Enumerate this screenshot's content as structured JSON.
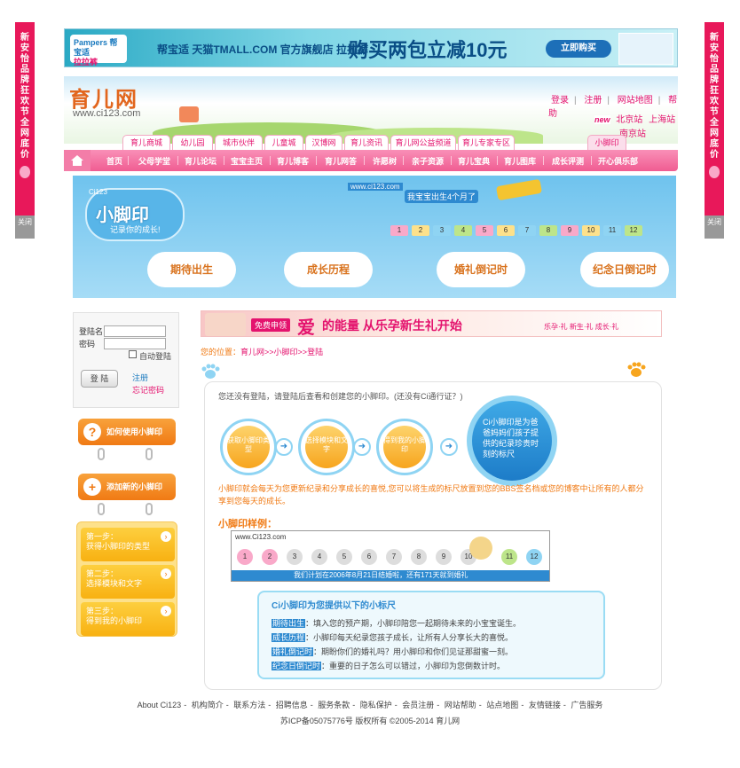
{
  "side_banner": {
    "text": "新安怡品牌狂欢节 全网底价",
    "close": "关闭"
  },
  "top_ad": {
    "brand": "Pampers 帮宝适",
    "lala": "拉拉裤",
    "store": "帮宝适 天猫TMALL.COM 官方旗舰店 拉拉裤",
    "promo": "购买两包立减10元",
    "button": "立即购买"
  },
  "header": {
    "logo": "育儿网",
    "logo_url": "www.ci123.com",
    "links": [
      "登录",
      "注册",
      "网站地图",
      "帮助"
    ],
    "new_badge": "new",
    "cities": [
      "北京站",
      "上海站"
    ],
    "nanjing": "南京站"
  },
  "tabs": [
    "育儿商城",
    "幼儿园",
    "城市伙伴",
    "儿童城",
    "汉博网",
    "育儿资讯",
    "育儿网公益频道",
    "育儿专家专区",
    "小脚印"
  ],
  "nav": [
    "首页",
    "父母学堂",
    "育儿论坛",
    "宝宝主页",
    "育儿博客",
    "育儿网答",
    "许愿树",
    "亲子资源",
    "育儿宝典",
    "育儿图库",
    "成长评测",
    "开心俱乐部"
  ],
  "banner": {
    "small": "Ci123",
    "title": "小脚印",
    "subtitle": "记录你的成长!",
    "url": "www.ci123.com",
    "bubble": "我宝宝出生4个月了",
    "numbers": [
      "1",
      "2",
      "3",
      "4",
      "5",
      "6",
      "7",
      "8",
      "9",
      "10",
      "11",
      "12"
    ],
    "clouds": [
      "期待出生",
      "成长历程",
      "婚礼倒记时",
      "纪念日倒记时"
    ]
  },
  "login": {
    "username_label": "登陆名",
    "password_label": "密码",
    "auto": "自动登陆",
    "button": "登 陆",
    "register": "注册",
    "forgot": "忘记密码"
  },
  "side_buttons": {
    "how": "如何使用小脚印",
    "add": "添加新的小脚印"
  },
  "steps": [
    {
      "title": "第一步：",
      "text": "获得小脚印的类型"
    },
    {
      "title": "第二步：",
      "text": "选择模块和文字"
    },
    {
      "title": "第三步：",
      "text": "得到我的小脚印"
    }
  ],
  "ad_bar": {
    "free": "免费申领",
    "love": "爱",
    "slogan": "的能量 从乐孕新生礼开始",
    "small": "乐孕·礼 新生·礼 成长·礼"
  },
  "breadcrumb": {
    "prefix": "您的位置：",
    "home": "育儿网",
    "mid": ">>小脚印>>",
    "current": "登陆"
  },
  "content": {
    "notice": "您还没有登陆，请登陆后查看和创建您的小脚印。(还没有Ci通行证？)",
    "flow": [
      "获取小脚印类型",
      "选择模块和文字",
      "得到我的小脚印"
    ],
    "circle": "Ci小脚印是为爸爸妈妈们孩子提供的纪录珍贵时刻的标尺",
    "desc": "小脚印就会每天为您更新纪录和分享成长的喜悦,您可以将生成的标尺放置到您的BBS签名档或您的博客中让所有的人都分享到您每天的成长。",
    "sample_heading": "小脚印样例：",
    "sample_url": "www.Ci123.com",
    "sample_text": "我们计划在2006年8月21日结婚啦，还有171天就到婚礼",
    "sample_nums": [
      "1",
      "2",
      "3",
      "4",
      "5",
      "6",
      "7",
      "8",
      "9",
      "10",
      "11",
      "12"
    ],
    "info_title": "Ci小脚印为您提供以下的小标尺",
    "info_rows": [
      {
        "key": "期待出生",
        "text": "：填入您的预产期，小脚印陪您一起期待未来的小宝宝诞生。"
      },
      {
        "key": "成长历程",
        "text": "：小脚印每天纪录您孩子成长，让所有人分享长大的喜悦。"
      },
      {
        "key": "婚礼倒记时",
        "text": "：期盼你们的婚礼吗？用小脚印和你们见证那甜蜜一刻。"
      },
      {
        "key": "纪念日倒记时",
        "text": "：重要的日子怎么可以错过，小脚印为您倒数计时。"
      }
    ]
  },
  "footer": {
    "links": [
      "About Ci123",
      "机构简介",
      "联系方法",
      "招聘信息",
      "服务条款",
      "隐私保护",
      "会员注册",
      "网站帮助",
      "站点地图",
      "友情链接",
      "广告服务"
    ],
    "copyright": "苏ICP备05075776号 版权所有 ©2005-2014 育儿网"
  },
  "colors": {
    "pink": "#e4136e",
    "orange": "#f07a14",
    "blue": "#2e8ad0"
  }
}
